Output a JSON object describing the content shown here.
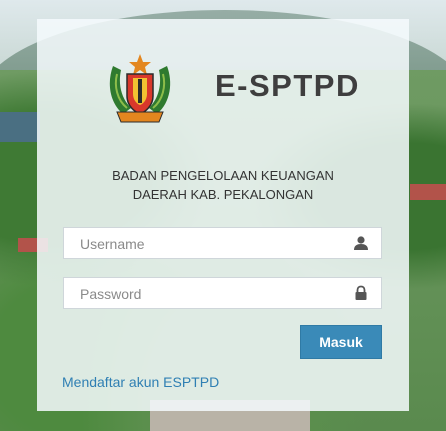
{
  "app": {
    "title": "E-SPTPD"
  },
  "organization": {
    "line1": "BADAN PENGELOLAAN KEUANGAN",
    "line2": "DAERAH KAB. PEKALONGAN"
  },
  "login_form": {
    "username": {
      "placeholder": "Username",
      "value": "",
      "icon": "user-icon"
    },
    "password": {
      "placeholder": "Password",
      "value": "",
      "icon": "lock-icon"
    },
    "submit_label": "Masuk"
  },
  "register_link": "Mendaftar akun ESPTPD",
  "colors": {
    "accent": "#3a8ab8",
    "link": "#2f7fb3",
    "title": "#3e3e3e"
  }
}
